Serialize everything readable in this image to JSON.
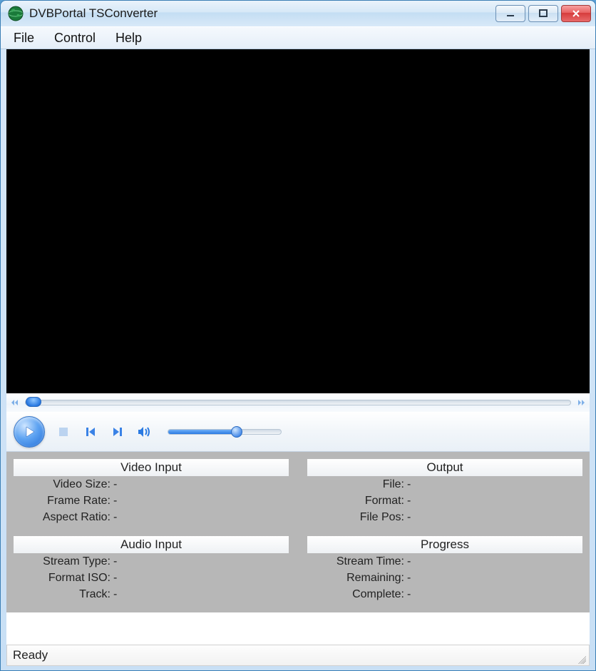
{
  "window": {
    "title": "DVBPortal TSConverter",
    "icon": "globe-icon"
  },
  "menubar": {
    "items": [
      "File",
      "Control",
      "Help"
    ]
  },
  "panels": {
    "video_input": {
      "header": "Video Input",
      "rows": [
        {
          "label": "Video Size:",
          "value": "-"
        },
        {
          "label": "Frame Rate:",
          "value": "-"
        },
        {
          "label": "Aspect Ratio:",
          "value": "-"
        }
      ]
    },
    "output": {
      "header": "Output",
      "rows": [
        {
          "label": "File:",
          "value": "-"
        },
        {
          "label": "Format:",
          "value": "-"
        },
        {
          "label": "File Pos:",
          "value": "-"
        }
      ]
    },
    "audio_input": {
      "header": "Audio Input",
      "rows": [
        {
          "label": "Stream Type:",
          "value": "-"
        },
        {
          "label": "Format ISO:",
          "value": "-"
        },
        {
          "label": "Track:",
          "value": "-"
        }
      ]
    },
    "progress": {
      "header": "Progress",
      "rows": [
        {
          "label": "Stream Time:",
          "value": "-"
        },
        {
          "label": "Remaining:",
          "value": "-"
        },
        {
          "label": "Complete:",
          "value": "-"
        }
      ]
    }
  },
  "statusbar": {
    "text": "Ready"
  },
  "playback": {
    "seek_percent": 0,
    "volume_percent": 58
  }
}
